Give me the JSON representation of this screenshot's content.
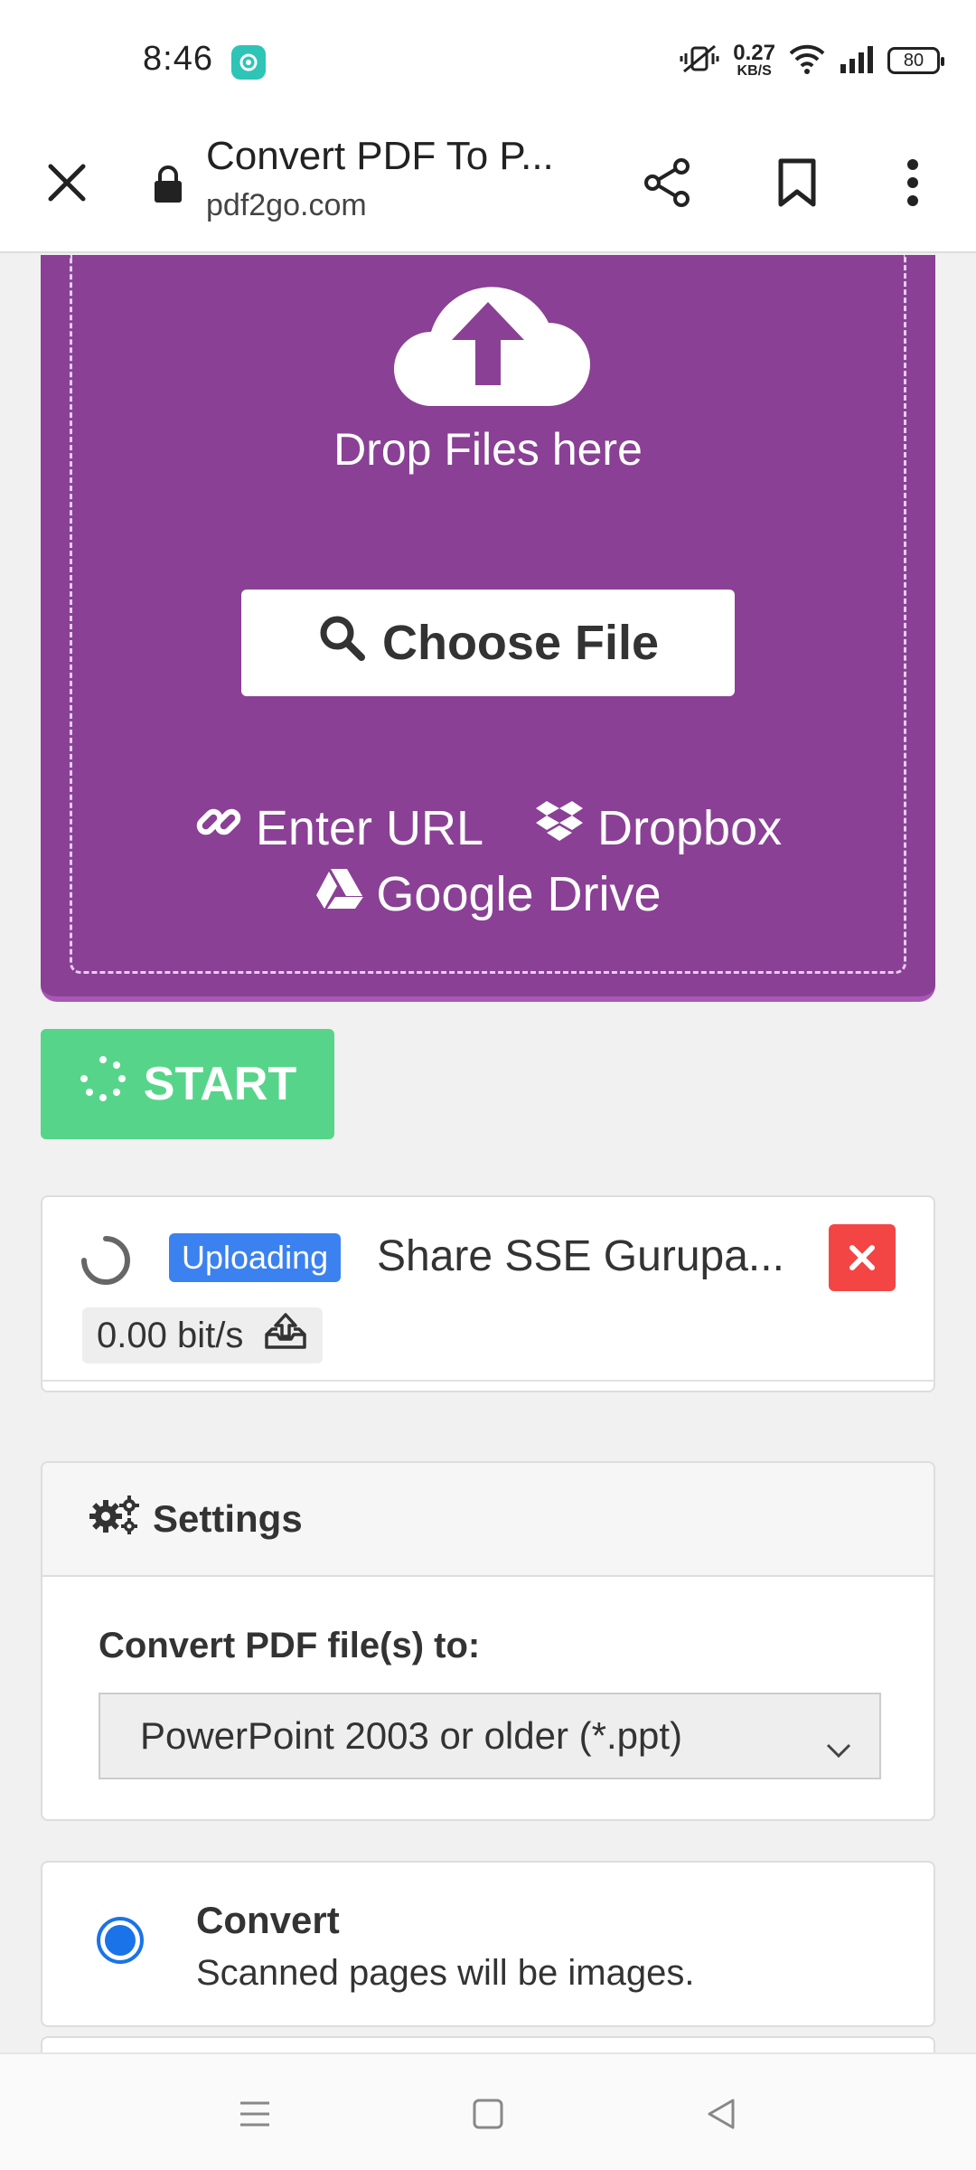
{
  "status_bar": {
    "time": "8:46",
    "net_speed_value": "0.27",
    "net_speed_unit": "KB/S",
    "battery": "80"
  },
  "browser": {
    "page_title": "Convert PDF To P...",
    "url": "pdf2go.com"
  },
  "upload": {
    "drop_text": "Drop Files here",
    "choose_file_label": "Choose File",
    "enter_url_label": "Enter URL",
    "dropbox_label": "Dropbox",
    "google_drive_label": "Google Drive"
  },
  "start_label": "START",
  "file_item": {
    "status": "Uploading",
    "name": "Share SSE Gurupa...",
    "speed": "0.00 bit/s"
  },
  "settings": {
    "title": "Settings",
    "convert_label": "Convert PDF file(s) to:",
    "selected_format": "PowerPoint 2003 or older (*.ppt)"
  },
  "option": {
    "title": "Convert",
    "description": "Scanned pages will be images."
  },
  "colors": {
    "upload_bg": "#8a4095",
    "start_green": "#56d58a",
    "uploading_badge": "#3b82f0",
    "remove_red": "#f44545",
    "radio_blue": "#1a73e8"
  }
}
